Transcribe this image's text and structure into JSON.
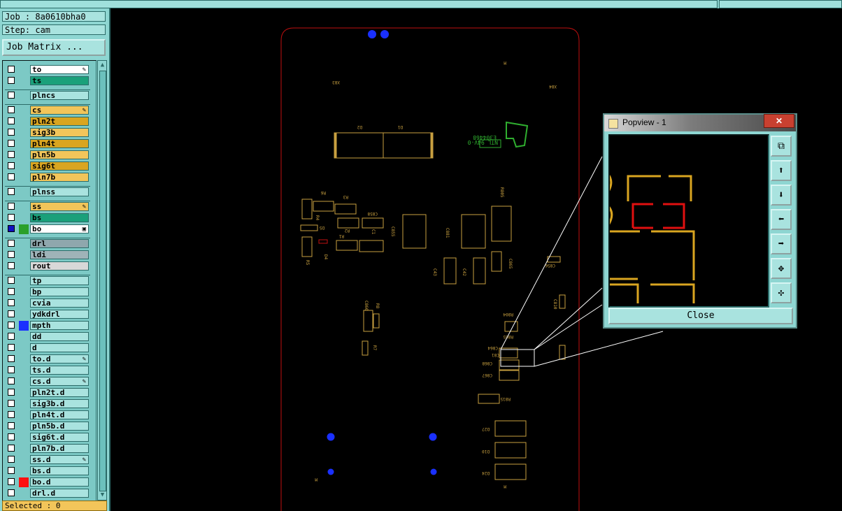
{
  "job": {
    "label": "Job : 8a0610bha0",
    "step": "Step: cam"
  },
  "job_matrix_button": "Job Matrix ...",
  "selected": "Selected : 0",
  "layers": [
    {
      "name": "to",
      "bg": "#ffffff",
      "edit": "✎",
      "swatch": ""
    },
    {
      "name": "ts",
      "bg": "#1aa07a",
      "edit": "",
      "swatch": ""
    },
    {
      "name": "plncs",
      "bg": "#a9e3df",
      "edit": "",
      "swatch": "",
      "gap": true
    },
    {
      "name": "cs",
      "bg": "#f2c55a",
      "edit": "✎",
      "swatch": "",
      "gap": true
    },
    {
      "name": "pln2t",
      "bg": "#d9a520",
      "edit": "",
      "swatch": ""
    },
    {
      "name": "sig3b",
      "bg": "#f2c55a",
      "edit": "",
      "swatch": ""
    },
    {
      "name": "pln4t",
      "bg": "#d9a520",
      "edit": "",
      "swatch": ""
    },
    {
      "name": "pln5b",
      "bg": "#f2c55a",
      "edit": "",
      "swatch": ""
    },
    {
      "name": "sig6t",
      "bg": "#d9a520",
      "edit": "",
      "swatch": ""
    },
    {
      "name": "pln7b",
      "bg": "#f2c55a",
      "edit": "",
      "swatch": ""
    },
    {
      "name": "plnss",
      "bg": "#a9e3df",
      "edit": "",
      "swatch": "",
      "gap": true
    },
    {
      "name": "ss",
      "bg": "#f2c55a",
      "edit": "✎",
      "swatch": "",
      "gap": true
    },
    {
      "name": "bs",
      "bg": "#1aa07a",
      "edit": "",
      "swatch": ""
    },
    {
      "name": "bo",
      "bg": "#ffffff",
      "edit": "▣",
      "swatch": "#2aa02a",
      "checkbg": "#1010c0"
    },
    {
      "name": "drl",
      "bg": "#8fa7ad",
      "edit": "",
      "swatch": "",
      "gap": true
    },
    {
      "name": "ldi",
      "bg": "#9fb3b8",
      "edit": "",
      "swatch": ""
    },
    {
      "name": "rout",
      "bg": "#d8d8d8",
      "edit": "",
      "swatch": ""
    },
    {
      "name": "tp",
      "bg": "#a9e3df",
      "edit": "",
      "swatch": "",
      "gap": true
    },
    {
      "name": "bp",
      "bg": "#a9e3df",
      "edit": "",
      "swatch": ""
    },
    {
      "name": "cvia",
      "bg": "#a9e3df",
      "edit": "",
      "swatch": ""
    },
    {
      "name": "ydkdrl",
      "bg": "#a9e3df",
      "edit": "",
      "swatch": ""
    },
    {
      "name": "mpth",
      "bg": "#a9e3df",
      "edit": "",
      "swatch": "#1a30ff"
    },
    {
      "name": "dd",
      "bg": "#a9e3df",
      "edit": "",
      "swatch": ""
    },
    {
      "name": "d",
      "bg": "#a9e3df",
      "edit": "",
      "swatch": ""
    },
    {
      "name": "to.d",
      "bg": "#a9e3df",
      "edit": "✎",
      "swatch": ""
    },
    {
      "name": "ts.d",
      "bg": "#a9e3df",
      "edit": "",
      "swatch": ""
    },
    {
      "name": "cs.d",
      "bg": "#a9e3df",
      "edit": "✎",
      "swatch": ""
    },
    {
      "name": "pln2t.d",
      "bg": "#a9e3df",
      "edit": "",
      "swatch": ""
    },
    {
      "name": "sig3b.d",
      "bg": "#a9e3df",
      "edit": "",
      "swatch": ""
    },
    {
      "name": "pln4t.d",
      "bg": "#a9e3df",
      "edit": "",
      "swatch": ""
    },
    {
      "name": "pln5b.d",
      "bg": "#a9e3df",
      "edit": "",
      "swatch": ""
    },
    {
      "name": "sig6t.d",
      "bg": "#a9e3df",
      "edit": "",
      "swatch": ""
    },
    {
      "name": "pln7b.d",
      "bg": "#a9e3df",
      "edit": "",
      "swatch": ""
    },
    {
      "name": "ss.d",
      "bg": "#a9e3df",
      "edit": "✎",
      "swatch": ""
    },
    {
      "name": "bs.d",
      "bg": "#a9e3df",
      "edit": "",
      "swatch": ""
    },
    {
      "name": "bo.d",
      "bg": "#a9e3df",
      "edit": "",
      "swatch": "#ff1010"
    },
    {
      "name": "drl.d",
      "bg": "#a9e3df",
      "edit": "",
      "swatch": ""
    }
  ],
  "board_labels": {
    "x83": "X83",
    "x84": "X84",
    "d2": "D2",
    "d1": "D1",
    "r6": "R6",
    "r3": "R3",
    "c858": "C858",
    "r4": "R4",
    "d5": "D5",
    "r2": "R2",
    "r1": "R1",
    "c1": "C1",
    "c855": "C855",
    "c881": "C881",
    "r805": "R805",
    "r5": "R5",
    "d4": "D4",
    "c43": "C43",
    "c42": "C42",
    "c865": "C865",
    "c856": "C856",
    "c860": "C860",
    "r8": "R8",
    "c810": "C810",
    "r7": "R7",
    "r804": "R804",
    "r865": "R865",
    "c864": "C864",
    "c81": "C81",
    "c868": "C868",
    "c867": "C867",
    "r815": "R815",
    "d27": "D27",
    "d10": "D10",
    "d24": "D24",
    "mark": "M"
  },
  "popview": {
    "title": "Popview - 1",
    "close_x": "✕",
    "close": "Close",
    "tools": [
      "zoom-window-icon",
      "pan-up-icon",
      "pan-down-icon",
      "pan-left-icon",
      "pan-right-icon",
      "zoom-fit-icon",
      "zoom-home-icon"
    ]
  },
  "colors": {
    "panel": "#8ed6d2",
    "outline": "#c01010",
    "silk": "#c8a040",
    "pad": "#1a30ff",
    "logo": "#2fae2f"
  }
}
